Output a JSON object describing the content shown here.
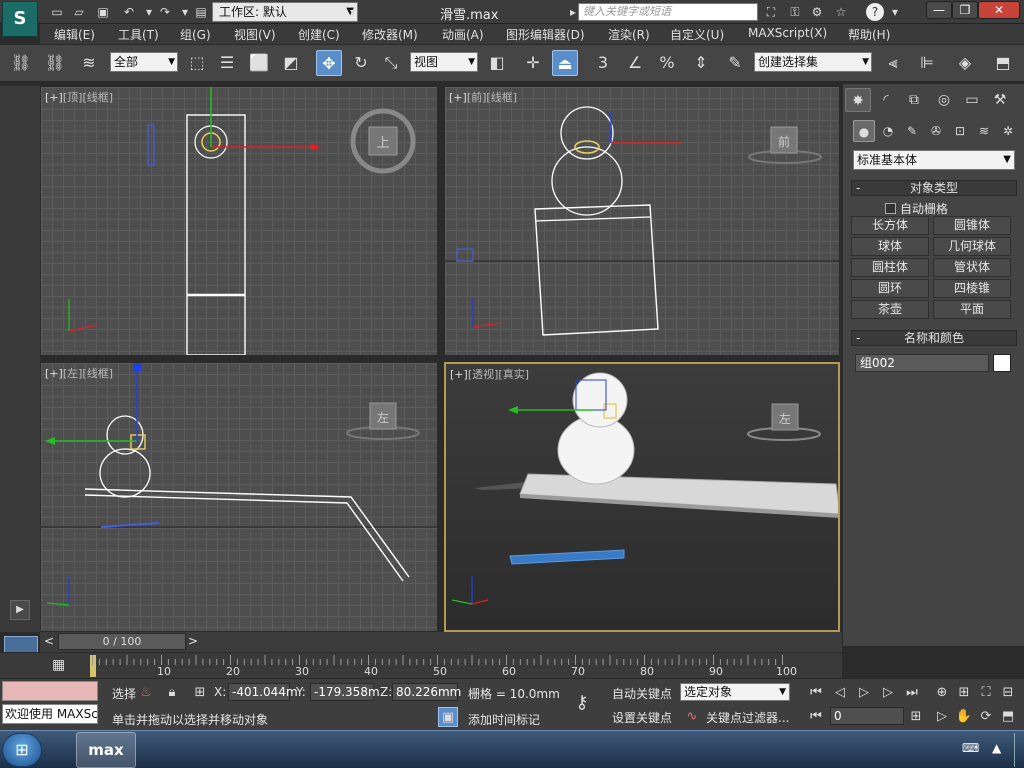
{
  "title_bar": {
    "workspace_label": "工作区: 默认",
    "document_title": "滑雪.max",
    "search_placeholder": "键入关键字或短语",
    "logo_text": "S"
  },
  "menu": [
    "编辑(E)",
    "工具(T)",
    "组(G)",
    "视图(V)",
    "创建(C)",
    "修改器(M)",
    "动画(A)",
    "图形编辑器(D)",
    "渲染(R)",
    "自定义(U)",
    "MAXScript(X)",
    "帮助(H)"
  ],
  "toolbar": {
    "selection_filter": "全部",
    "reference_coord": "视图",
    "named_selection": "创建选择集",
    "snap_label": "3",
    "percent_label": "%"
  },
  "viewports": {
    "top": {
      "bracket": "[+]",
      "name": "[顶]",
      "shading": "[线框]",
      "viewcube": "上"
    },
    "front": {
      "bracket": "[+]",
      "name": "[前]",
      "shading": "[线框]",
      "viewcube": "前"
    },
    "left": {
      "bracket": "[+]",
      "name": "[左]",
      "shading": "[线框]",
      "viewcube": "左"
    },
    "persp": {
      "bracket": "[+]",
      "name": "[透视]",
      "shading": "[真实]",
      "viewcube": "左"
    }
  },
  "command_panel": {
    "category": "标准基本体",
    "object_type_header": "对象类型",
    "autogrid_label": "自动栅格",
    "primitives": [
      "长方体",
      "圆锥体",
      "球体",
      "几何球体",
      "圆柱体",
      "管状体",
      "圆环",
      "四棱锥",
      "茶壶",
      "平面"
    ],
    "name_color_header": "名称和颜色",
    "object_name": "组002",
    "object_color": "#ffffff"
  },
  "timeline": {
    "slider_text": "0 / 100",
    "ticks": [
      "10",
      "20",
      "30",
      "40",
      "50",
      "60",
      "70",
      "80",
      "90",
      "100"
    ]
  },
  "status": {
    "welcome": "欢迎使用 MAXSc",
    "selected_label": "选择",
    "x_label": "X:",
    "x_value": "-401.044m",
    "y_label": "Y:",
    "y_value": "-179.358m",
    "z_label": "Z:",
    "z_value": "80.226mm",
    "grid_text": "栅格 = 10.0mm",
    "prompt": "单击并拖动以选择并移动对象",
    "add_time_tag": "添加时间标记",
    "auto_key": "自动关键点",
    "set_key": "设置关键点",
    "key_mode_select": "选定对象",
    "key_filter": "关键点过滤器...",
    "frame_value": "0"
  },
  "taskbar": {
    "max_label": "max",
    "tray_icon": "⌨"
  },
  "colors": {
    "axis_x": "#e02020",
    "axis_y": "#20c020",
    "axis_z": "#2040e0",
    "viewport_border_active": "#b29a4e",
    "highlight": "#5a8ec9"
  }
}
